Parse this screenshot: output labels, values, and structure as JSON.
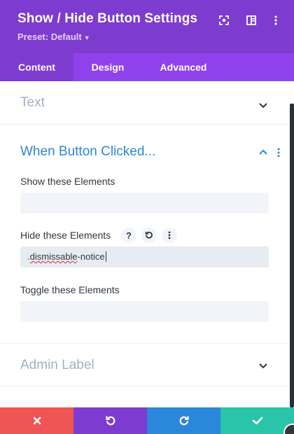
{
  "header": {
    "title": "Show / Hide Button Settings",
    "preset": "Preset: Default",
    "icons": [
      "expand-icon",
      "sidebar-toggle-icon",
      "more-vertical-icon"
    ]
  },
  "tabs": [
    {
      "label": "Content",
      "active": true
    },
    {
      "label": "Design",
      "active": false
    },
    {
      "label": "Advanced",
      "active": false
    }
  ],
  "sections": {
    "text": {
      "title": "Text",
      "expanded": false
    },
    "clicked": {
      "title": "When Button Clicked...",
      "expanded": true,
      "show_label": "Show these Elements",
      "show_value": "",
      "hide_label": "Hide these Elements",
      "hide_value_spell": "dismissable",
      "hide_value_pre": ".",
      "hide_value_post": "-notice",
      "toggle_label": "Toggle these Elements",
      "toggle_value": ""
    },
    "admin": {
      "title": "Admin Label",
      "expanded": false
    }
  },
  "footer": [
    "cancel-icon",
    "undo-icon",
    "redo-icon",
    "save-check-icon"
  ],
  "colors": {
    "header": "#7e3bd0",
    "tabs": "#8f42ec",
    "accent_blue": "#2b87da",
    "cancel": "#ef5555",
    "save": "#29c4a9"
  }
}
